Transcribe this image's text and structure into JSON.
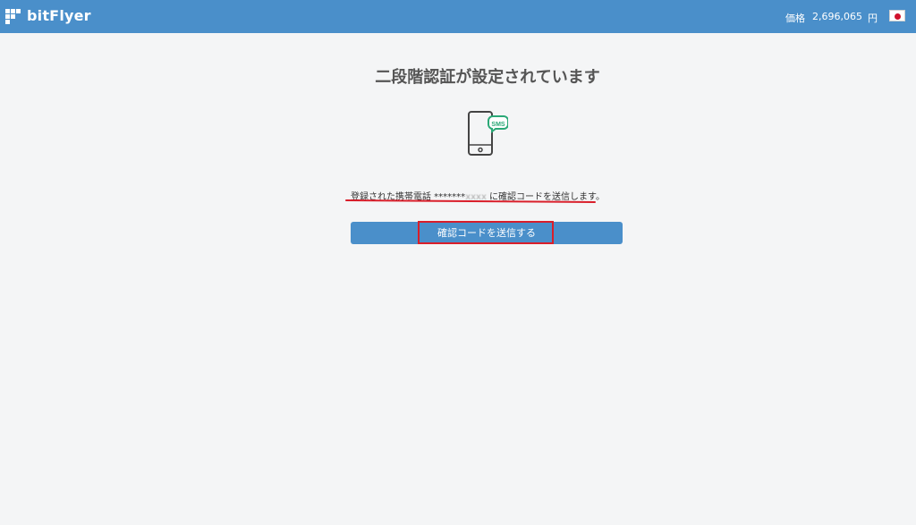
{
  "header": {
    "brand": "bitFlyer",
    "price_label": "価格",
    "price_value": "2,696,065",
    "price_unit": "円",
    "flag_icon": "japan-flag-icon",
    "colors": {
      "header_bg": "#4a8fca",
      "flag_red": "#d0112b"
    }
  },
  "main": {
    "title": "二段階認証が設定されています",
    "phone_icon": "phone-sms-icon",
    "sms_badge": "SMS",
    "message_before": "登録された携帯電話 *******",
    "message_masked": "xxxx",
    "message_after": " に確認コードを送信します。",
    "send_button_label": "確認コードを送信する",
    "colors": {
      "icon_green": "#2aa876",
      "annotation_red": "#d91e2a",
      "button_bg": "#4a8fca"
    }
  }
}
